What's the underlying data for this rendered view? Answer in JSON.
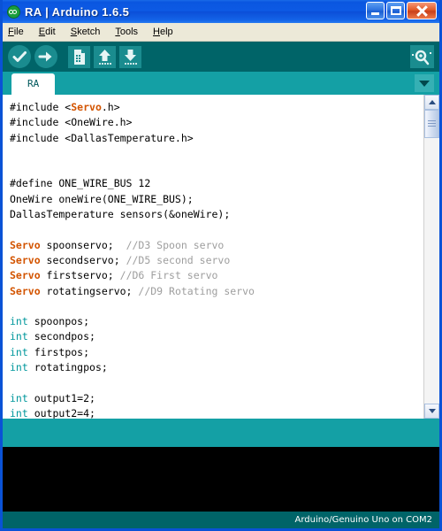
{
  "window": {
    "app_icon": "arduino-logo-icon",
    "title": "RA | Arduino 1.6.5",
    "buttons": {
      "minimize": "minimize-button",
      "maximize": "maximize-button",
      "close": "close-button"
    }
  },
  "menubar": {
    "items": [
      {
        "label": "File",
        "mnemonic": "F"
      },
      {
        "label": "Edit",
        "mnemonic": "E"
      },
      {
        "label": "Sketch",
        "mnemonic": "S"
      },
      {
        "label": "Tools",
        "mnemonic": "T"
      },
      {
        "label": "Help",
        "mnemonic": "H"
      }
    ]
  },
  "toolbar": {
    "verify_label": "Verify",
    "upload_label": "Upload",
    "new_label": "New",
    "open_label": "Open",
    "save_label": "Save",
    "serial_monitor_label": "Serial Monitor",
    "background_color": "#006468",
    "button_color": "#1a8c8f"
  },
  "tabs": {
    "items": [
      {
        "label": "RA",
        "active": true
      }
    ],
    "dropdown_label": "tab-menu",
    "strip_color": "#14a0a5"
  },
  "editor": {
    "background_color": "#ffffff",
    "colors": {
      "keyword_type": "#00979c",
      "class_name": "#d35400",
      "comment": "#9e9e9e",
      "text": "#000000"
    },
    "lines": [
      {
        "tokens": [
          {
            "t": "#include <",
            "c": "plain"
          },
          {
            "t": "Servo",
            "c": "class"
          },
          {
            "t": ".h>",
            "c": "plain"
          }
        ]
      },
      {
        "tokens": [
          {
            "t": "#include <OneWire.h>",
            "c": "plain"
          }
        ]
      },
      {
        "tokens": [
          {
            "t": "#include <DallasTemperature.h>",
            "c": "plain"
          }
        ]
      },
      {
        "tokens": []
      },
      {
        "tokens": []
      },
      {
        "tokens": [
          {
            "t": "#define ONE_WIRE_BUS 12",
            "c": "plain"
          }
        ]
      },
      {
        "tokens": [
          {
            "t": "OneWire oneWire(ONE_WIRE_BUS);",
            "c": "plain"
          }
        ]
      },
      {
        "tokens": [
          {
            "t": "DallasTemperature sensors(&oneWire);",
            "c": "plain"
          }
        ]
      },
      {
        "tokens": []
      },
      {
        "tokens": [
          {
            "t": "Servo",
            "c": "class"
          },
          {
            "t": " spoonservo;  ",
            "c": "plain"
          },
          {
            "t": "//D3 Spoon servo",
            "c": "comment"
          }
        ]
      },
      {
        "tokens": [
          {
            "t": "Servo",
            "c": "class"
          },
          {
            "t": " secondservo; ",
            "c": "plain"
          },
          {
            "t": "//D5 second servo",
            "c": "comment"
          }
        ]
      },
      {
        "tokens": [
          {
            "t": "Servo",
            "c": "class"
          },
          {
            "t": " firstservo; ",
            "c": "plain"
          },
          {
            "t": "//D6 First servo",
            "c": "comment"
          }
        ]
      },
      {
        "tokens": [
          {
            "t": "Servo",
            "c": "class"
          },
          {
            "t": " rotatingservo; ",
            "c": "plain"
          },
          {
            "t": "//D9 Rotating servo",
            "c": "comment"
          }
        ]
      },
      {
        "tokens": []
      },
      {
        "tokens": [
          {
            "t": "int",
            "c": "type"
          },
          {
            "t": " spoonpos;",
            "c": "plain"
          }
        ]
      },
      {
        "tokens": [
          {
            "t": "int",
            "c": "type"
          },
          {
            "t": " secondpos;",
            "c": "plain"
          }
        ]
      },
      {
        "tokens": [
          {
            "t": "int",
            "c": "type"
          },
          {
            "t": " firstpos;",
            "c": "plain"
          }
        ]
      },
      {
        "tokens": [
          {
            "t": "int",
            "c": "type"
          },
          {
            "t": " rotatingpos;",
            "c": "plain"
          }
        ]
      },
      {
        "tokens": []
      },
      {
        "tokens": [
          {
            "t": "int",
            "c": "type"
          },
          {
            "t": " output1=2;",
            "c": "plain"
          }
        ]
      },
      {
        "tokens": [
          {
            "t": "int",
            "c": "type"
          },
          {
            "t": " output2=4;",
            "c": "plain"
          }
        ]
      }
    ]
  },
  "scrollbar": {
    "up_label": "scroll-up",
    "down_label": "scroll-down",
    "thumb_label": "scroll-thumb"
  },
  "console": {
    "text": "",
    "background_color": "#000000"
  },
  "statusbar": {
    "board_text": "Arduino/Genuino Uno on COM2",
    "background_color": "#006468"
  }
}
